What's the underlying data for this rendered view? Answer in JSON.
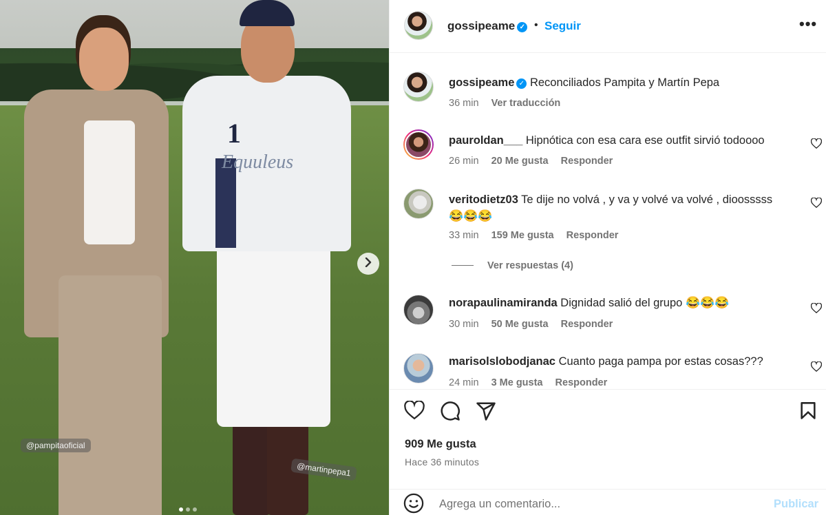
{
  "photo": {
    "tag_left": "@pampitaoficial",
    "tag_right": "@martinpepa1",
    "shirt_number": "1",
    "shirt_brand": "Equuleus",
    "carousel_dots": 3,
    "carousel_active": 1,
    "next_icon": "chevron-right-icon"
  },
  "header": {
    "username": "gossipeame",
    "separator": "•",
    "follow_label": "Seguir",
    "more_icon": "•••"
  },
  "caption": {
    "username": "gossipeame",
    "text": "Reconciliados Pampita y Martín Pepa",
    "time": "36 min",
    "translate": "Ver traducción"
  },
  "comments": [
    {
      "username": "pauroldan___",
      "text": "Hipnótica con esa cara ese outfit sirvió todoooo",
      "time": "26 min",
      "likes": "20 Me gusta",
      "reply": "Responder"
    },
    {
      "username": "veritodietz03",
      "text": "Te dije no volvá , y va y volvé va volvé , dioosssss",
      "emoji": "😂😂😂",
      "time": "33 min",
      "likes": "159 Me gusta",
      "reply": "Responder"
    },
    {
      "username": "norapaulinamiranda",
      "text": "Dignidad salió del grupo",
      "emoji": "😂😂😂",
      "time": "30 min",
      "likes": "50 Me gusta",
      "reply": "Responder"
    },
    {
      "username": "marisolslobodjanac",
      "text": "Cuanto paga pampa por estas cosas???",
      "time": "24 min",
      "likes": "3 Me gusta",
      "reply": "Responder"
    }
  ],
  "view_replies": "Ver respuestas (4)",
  "actions": {
    "likes": "909 Me gusta",
    "posted_ago": "Hace 36 minutos"
  },
  "composer": {
    "placeholder": "Agrega un comentario...",
    "publish_label": "Publicar"
  },
  "colors": {
    "accent": "#0095f6",
    "muted": "#737373",
    "publish_disabled": "#b2dffc"
  }
}
